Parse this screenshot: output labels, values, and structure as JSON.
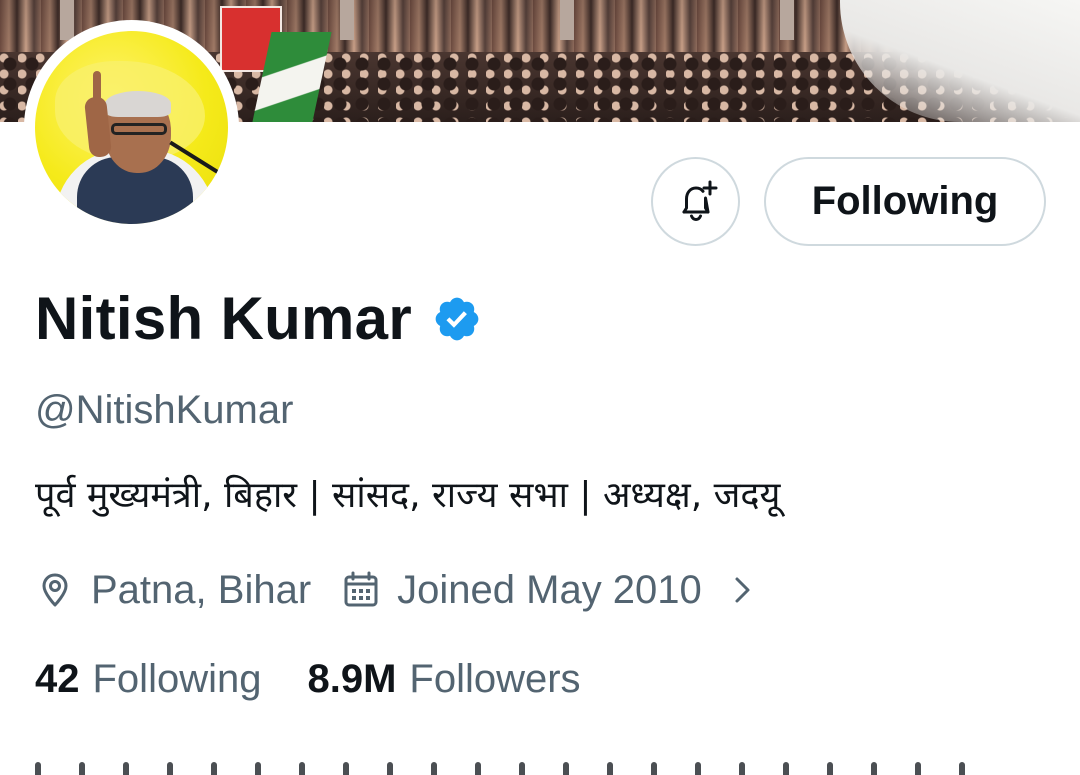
{
  "profile": {
    "display_name": "Nitish Kumar",
    "verified": true,
    "handle": "@NitishKumar",
    "bio": "पूर्व मुख्यमंत्री, बिहार | सांसद, राज्य सभा | अध्यक्ष, जदयू",
    "location": "Patna, Bihar",
    "joined": "Joined May 2010"
  },
  "actions": {
    "notify_icon": "bell-plus-icon",
    "follow_label": "Following"
  },
  "stats": {
    "following_count": "42",
    "following_label": "Following",
    "followers_count": "8.9M",
    "followers_label": "Followers"
  },
  "colors": {
    "verified_blue": "#1d9bf0",
    "secondary_text": "#536471",
    "primary_text": "#0f1419",
    "border": "#cfd9de"
  }
}
